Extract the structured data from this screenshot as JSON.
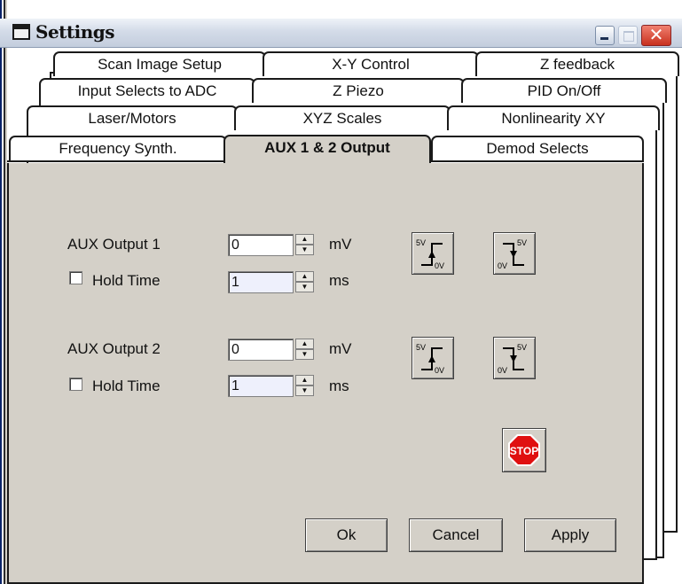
{
  "window": {
    "title": "Settings",
    "close_glyph": "✕"
  },
  "tabs": {
    "row1": [
      "Scan Image Setup",
      "X-Y Control",
      "Z feedback"
    ],
    "row2": [
      "Input Selects to ADC",
      "Z Piezo",
      "PID  On/Off"
    ],
    "row3": [
      "Laser/Motors",
      "XYZ Scales",
      "Nonlinearity XY"
    ],
    "row4": [
      "Frequency Synth.",
      "AUX 1 & 2 Output",
      "Demod  Selects"
    ]
  },
  "aux1": {
    "label": "AUX  Output  1",
    "value": "0",
    "unit": "mV",
    "hold_label": "Hold Time",
    "hold_value": "1",
    "hold_unit": "ms"
  },
  "aux2": {
    "label": "AUX  Output  2",
    "value": "0",
    "unit": "mV",
    "hold_label": "Hold Time",
    "hold_value": "1",
    "hold_unit": "ms"
  },
  "voltage_buttons": {
    "high": "5V",
    "low": "0V"
  },
  "spinner": {
    "up": "▲",
    "down": "▼"
  },
  "stop_label": "STOP",
  "footer": {
    "ok": "Ok",
    "cancel": "Cancel",
    "apply": "Apply"
  },
  "icons": [
    "window-icon",
    "minimize-icon",
    "maximize-icon",
    "close-icon",
    "step-up-icon",
    "step-down-icon",
    "stop-sign-icon"
  ]
}
